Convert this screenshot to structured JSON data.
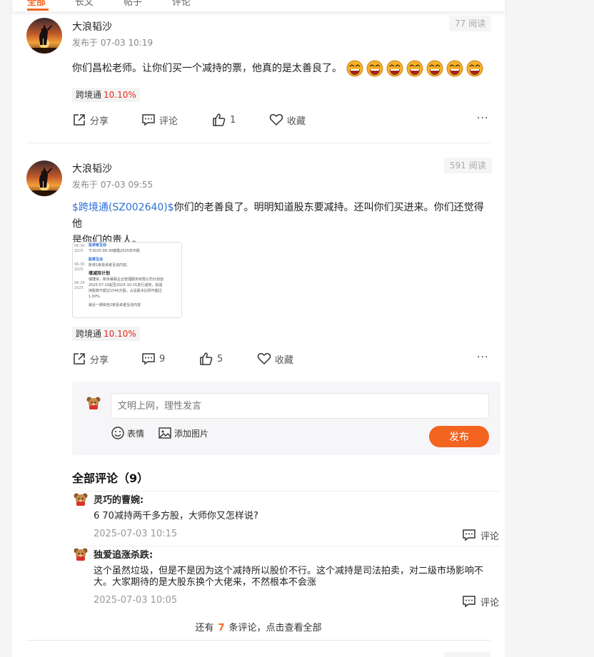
{
  "tabs": [
    {
      "label": "全部",
      "active": true
    },
    {
      "label": "长文",
      "active": false
    },
    {
      "label": "帖子",
      "active": false
    },
    {
      "label": "评论",
      "active": false
    }
  ],
  "posts": [
    {
      "author": "大浪韬沙",
      "time": "发布于 07-03 10:19",
      "reads": "77 阅读",
      "text": "你们昌松老师。让你们买一个减持的票，他真的是太善良了。",
      "emoji_count": 7,
      "stock_name": "跨境通",
      "stock_pct": "10.10%",
      "share": "分享",
      "comment": "评论",
      "likes": "1",
      "fav": "收藏"
    },
    {
      "author": "大浪韬沙",
      "time": "发布于 07-03 09:55",
      "reads": "591 阅读",
      "link": "$跨境通(SZ002640)$",
      "text_line1": "你们的老善良了。明明知道股东要减持。还叫你们买进来。你们还觉得他",
      "text_line2": "是你们的贵人。",
      "stock_name": "跨境通",
      "stock_pct": "10.10%",
      "share": "分享",
      "comments": "9",
      "likes": "5",
      "fav": "收藏",
      "thumb": {
        "dates": [
          "06-30",
          "2025",
          "06-30",
          "2025",
          "06-24",
          "2025"
        ],
        "lines": [
          "投资者互动",
          "于2025-06-30披露2025年中报",
          "股票互动",
          "新增1条投资者互动内容。",
          "增减持计划",
          "瑞捷资，新余睿联企业管理服务有限公司计划自",
          "2025-07-15起至2025-10-15进行减持，拟减",
          "持股数不超过1540万股，占总股本比例不超过",
          "1.00%",
          "最近一期有些2条投资者互动内容"
        ]
      }
    }
  ],
  "reply_box": {
    "placeholder": "文明上网，理性发言",
    "emoji_label": "表情",
    "image_label": "添加图片",
    "send_label": "发布"
  },
  "comments_section": {
    "heading": "全部评论（9）",
    "items": [
      {
        "name": "灵巧的曹婉:",
        "text": "6 70减持两千多方股，大师你又怎样说?",
        "time": "2025-07-03 10:15",
        "reply_label": "评论"
      },
      {
        "name": "独爱追涨杀跌:",
        "text": "这个虽然垃圾，但是不是因为这个减持所以股价不行。这个减持是司法拍卖，对二级市场影响不大。大家期待的是大股东换个大佬来，不然根本不会涨",
        "time": "2025-07-03 10:05",
        "reply_label": "评论"
      }
    ],
    "more_prefix": "还有",
    "more_count": "7",
    "more_suffix": "条评论，点击查看全部"
  }
}
